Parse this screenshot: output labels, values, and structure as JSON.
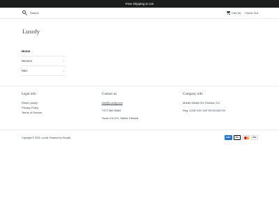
{
  "announcement": {
    "text": "Free shipping to US"
  },
  "header": {
    "search_placeholder": "Search",
    "cart_label": "Cart (0)",
    "checkout_label": "Check Out"
  },
  "logo": {
    "text": "Luxofy"
  },
  "nav": {
    "items": [
      {
        "label": "Home",
        "chevron": ""
      },
      {
        "label": "Women",
        "chevron": "›"
      },
      {
        "label": "Men",
        "chevron": "›"
      }
    ]
  },
  "footer": {
    "legal": {
      "title": "Legal info",
      "links": [
        "Return policy",
        "Privacy Policy",
        "Terms of Service"
      ]
    },
    "contact": {
      "title": "Contact us",
      "email": "info@Luxofy.com",
      "phone": "+372 56078683",
      "address": "Tuukri 19-219, Tallinn, Estonia"
    },
    "company": {
      "title": "Company info",
      "name": "Mobile Media OÜ, Estonia, EU.",
      "reg": "Reg. 12267139; VAT EE101552729"
    },
    "copyright": "Copyright © 2023, Luxofy. Powered by Shopify",
    "payments": [
      "AMEX",
      "Pay",
      "mastercard",
      "VISA"
    ]
  },
  "colors": {
    "announcement_bg": "#1c1d1d",
    "text": "#3d4246",
    "amex": "#1f72cd",
    "visa": "#1a1f71"
  },
  "icons": {
    "search": "search-icon",
    "cart": "cart-icon"
  }
}
